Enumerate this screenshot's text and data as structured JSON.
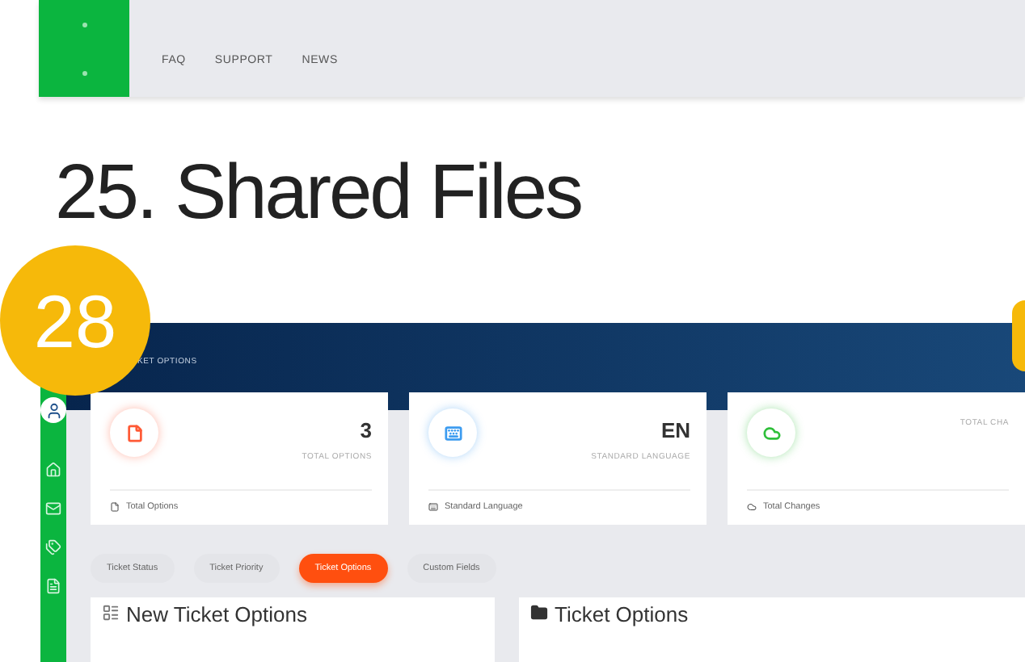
{
  "top_nav": {
    "links": [
      "FAQ",
      "SUPPORT",
      "NEWS"
    ]
  },
  "heading": "25. Shared Files",
  "step_badge": "28",
  "screenshot": {
    "header_title": "KET OPTIONS",
    "stats": [
      {
        "kind": "file",
        "color": "#ff5a36",
        "value": "3",
        "label": "TOTAL OPTIONS",
        "footer": "Total Options"
      },
      {
        "kind": "keyboard",
        "color": "#3d9cf0",
        "value": "EN",
        "label": "STANDARD LANGUAGE",
        "footer": "Standard Language"
      },
      {
        "kind": "cloud",
        "color": "#2fbf3a",
        "label": "TOTAL CHA",
        "footer": "Total Changes"
      }
    ],
    "tabs": [
      {
        "label": "Ticket Status",
        "selected": false
      },
      {
        "label": "Ticket Priority",
        "selected": false
      },
      {
        "label": "Ticket Options",
        "selected": true
      },
      {
        "label": "Custom Fields",
        "selected": false
      }
    ],
    "panels": [
      {
        "kind": "new",
        "title": "New Ticket Options"
      },
      {
        "kind": "list",
        "title": "Ticket Options"
      }
    ]
  }
}
